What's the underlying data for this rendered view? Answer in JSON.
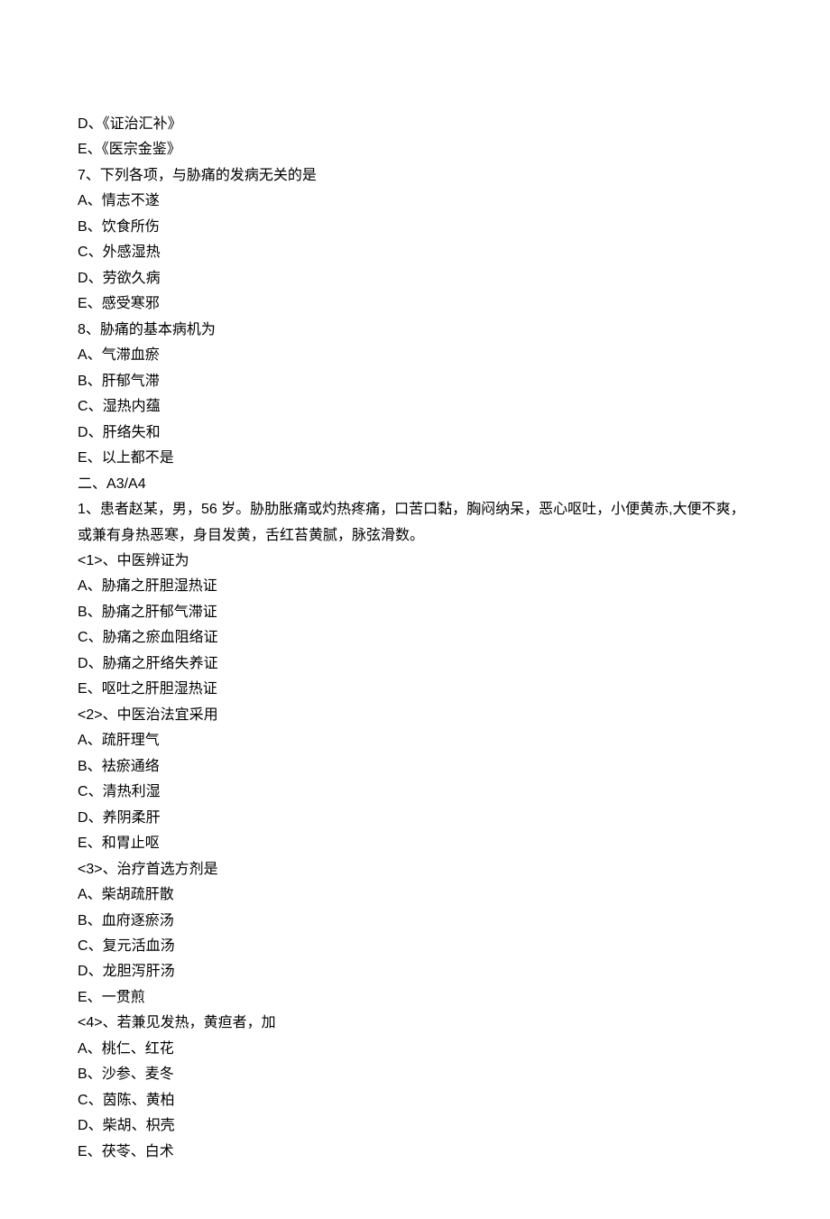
{
  "lines": {
    "l0": {
      "label": "D",
      "text": "《证治汇补》"
    },
    "l1": {
      "label": "E",
      "text": "《医宗金鉴》"
    },
    "l2": {
      "label": "7",
      "text": "下列各项，与胁痛的发病无关的是"
    },
    "l3": {
      "label": "A",
      "text": "情志不遂"
    },
    "l4": {
      "label": "B",
      "text": "饮食所伤"
    },
    "l5": {
      "label": "C",
      "text": "外感湿热"
    },
    "l6": {
      "label": "D",
      "text": "劳欲久病"
    },
    "l7": {
      "label": "E",
      "text": "感受寒邪"
    },
    "l8": {
      "label": "8",
      "text": "胁痛的基本病机为"
    },
    "l9": {
      "label": "A",
      "text": "气滞血瘀"
    },
    "l10": {
      "label": "B",
      "text": "肝郁气滞"
    },
    "l11": {
      "label": "C",
      "text": "湿热内蕴"
    },
    "l12": {
      "label": "D",
      "text": "肝络失和"
    },
    "l13": {
      "label": "E",
      "text": "以上都不是"
    },
    "l14": {
      "label": "二、",
      "text": "A3/A4"
    },
    "l15": {
      "label": "1",
      "text_a": "患者赵某，男，",
      "age": "56",
      "text_b": " 岁。胁肋胀痛或灼热疼痛，口苦口黏，胸闷纳呆，恶心呕吐，小便黄赤,大便不爽，或兼有身热恶寒，身目发黄，舌红苔黄腻，脉弦滑数。"
    },
    "l16": {
      "label": "<1>",
      "text": "中医辨证为"
    },
    "l17": {
      "label": "A",
      "text": "胁痛之肝胆湿热证"
    },
    "l18": {
      "label": "B",
      "text": "胁痛之肝郁气滞证"
    },
    "l19": {
      "label": "C",
      "text": "胁痛之瘀血阻络证"
    },
    "l20": {
      "label": "D",
      "text": "胁痛之肝络失养证"
    },
    "l21": {
      "label": "E",
      "text": "呕吐之肝胆湿热证"
    },
    "l22": {
      "label": "<2>",
      "text": "中医治法宜采用"
    },
    "l23": {
      "label": "A",
      "text": "疏肝理气"
    },
    "l24": {
      "label": "B",
      "text": "袪瘀通络"
    },
    "l25": {
      "label": "C",
      "text": "清热利湿"
    },
    "l26": {
      "label": "D",
      "text": "养阴柔肝"
    },
    "l27": {
      "label": "E",
      "text": "和胃止呕"
    },
    "l28": {
      "label": "<3>",
      "text": "治疗首选方剂是"
    },
    "l29": {
      "label": "A",
      "text": "柴胡疏肝散"
    },
    "l30": {
      "label": "B",
      "text": "血府逐瘀汤"
    },
    "l31": {
      "label": "C",
      "text": "复元活血汤"
    },
    "l32": {
      "label": "D",
      "text": "龙胆泻肝汤"
    },
    "l33": {
      "label": "E",
      "text": "一贯煎"
    },
    "l34": {
      "label": "<4>",
      "text": "若兼见发热，黄疸者，加"
    },
    "l35": {
      "label": "A",
      "text": "桃仁、红花"
    },
    "l36": {
      "label": "B",
      "text": "沙参、麦冬"
    },
    "l37": {
      "label": "C",
      "text": "茵陈、黄柏"
    },
    "l38": {
      "label": "D",
      "text": "柴胡、枳壳"
    },
    "l39": {
      "label": "E",
      "text": "茯苓、白术"
    }
  }
}
